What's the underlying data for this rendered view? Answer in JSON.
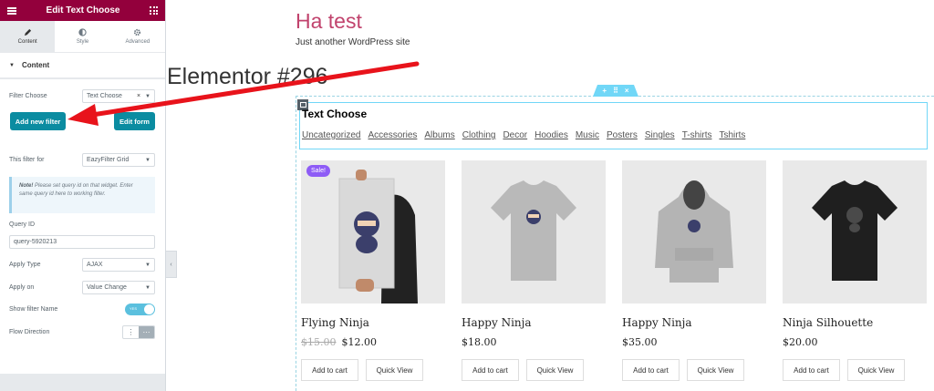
{
  "panel": {
    "title": "Edit Text Choose",
    "tabs": [
      {
        "label": "Content",
        "icon": "pencil-icon"
      },
      {
        "label": "Style",
        "icon": "half-circle-icon"
      },
      {
        "label": "Advanced",
        "icon": "gear-icon"
      }
    ],
    "section_label": "Content",
    "filter_choose_label": "Filter Choose",
    "filter_choose_value": "Text Choose",
    "add_new_filter": "Add new filter",
    "edit_form": "Edit form",
    "this_filter_for_label": "This filter for",
    "this_filter_for_value": "EazyFilter Grid",
    "note_bold": "Note!",
    "note_text": " Please set query id on that widget. Enter same query id here to working filter.",
    "query_id_label": "Query ID",
    "query_id_value": "query-5920213",
    "apply_type_label": "Apply Type",
    "apply_type_value": "AJAX",
    "apply_on_label": "Apply on",
    "apply_on_value": "Value Change",
    "show_filter_name_label": "Show filter Name",
    "toggle_text": "YES",
    "flow_direction_label": "Flow Direction"
  },
  "site": {
    "title": "Ha test",
    "description": "Just another WordPress site"
  },
  "page_title": "Elementor #296",
  "widget": {
    "title": "Text Choose",
    "filters": [
      "Uncategorized",
      "Accessories",
      "Albums",
      "Clothing",
      "Decor",
      "Hoodies",
      "Music",
      "Posters",
      "Singles",
      "T-shirts",
      "Tshirts"
    ]
  },
  "products": [
    {
      "name": "Flying Ninja",
      "old_price": "$15.00",
      "price": "$12.00",
      "sale": "Sale!",
      "add": "Add to cart",
      "quick": "Quick View"
    },
    {
      "name": "Happy Ninja",
      "old_price": "",
      "price": "$18.00",
      "sale": "",
      "add": "Add to cart",
      "quick": "Quick View"
    },
    {
      "name": "Happy Ninja",
      "old_price": "",
      "price": "$35.00",
      "sale": "",
      "add": "Add to cart",
      "quick": "Quick View"
    },
    {
      "name": "Ninja Silhouette",
      "old_price": "",
      "price": "$20.00",
      "sale": "",
      "add": "Add to cart",
      "quick": "Quick View"
    }
  ],
  "colors": {
    "brand": "#93003c",
    "accent": "#0b8ca1",
    "site_title": "#c1436d",
    "annotation_arrow": "#e8131b"
  }
}
